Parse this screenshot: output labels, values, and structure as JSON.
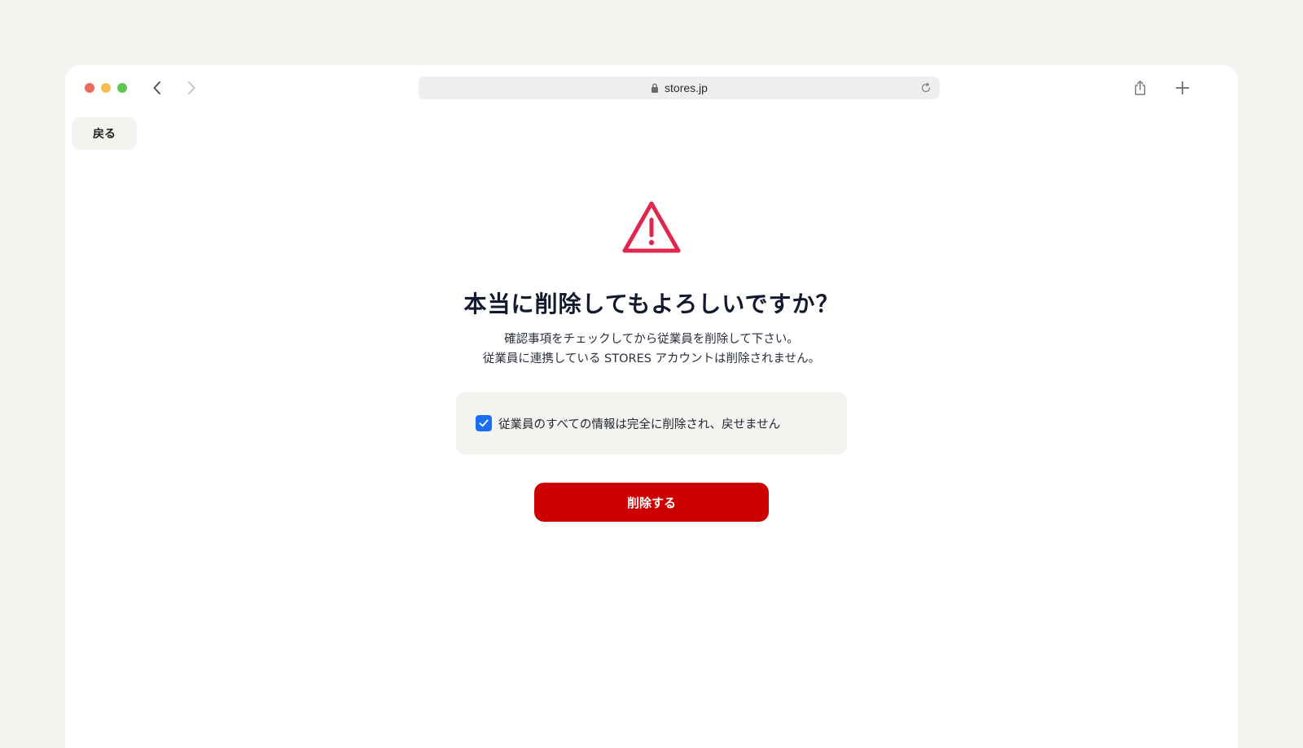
{
  "browser": {
    "url": "stores.jp",
    "traffic_colors": [
      "#ec6a5e",
      "#f4bf4f",
      "#61c554"
    ]
  },
  "page": {
    "back_label": "戻る",
    "title": "本当に削除してもよろしいですか？",
    "description_line1": "確認事項をチェックしてから従業員を削除して下さい。",
    "description_line2": "従業員に連携している STORES アカウントは削除されません。",
    "confirm_checkbox": {
      "label": "従業員のすべての情報は完全に削除され、戻せません",
      "checked": true
    },
    "delete_button_label": "削除する"
  },
  "colors": {
    "warning": "#e0284e",
    "danger": "#cc0000",
    "checkbox": "#1a6ff2"
  },
  "icons": {
    "warning": "warning-triangle-icon",
    "lock": "lock-icon",
    "reload": "reload-icon",
    "share": "share-icon",
    "new_tab": "plus-icon",
    "back": "chevron-left-icon",
    "forward": "chevron-right-icon",
    "check": "checkmark-icon"
  }
}
